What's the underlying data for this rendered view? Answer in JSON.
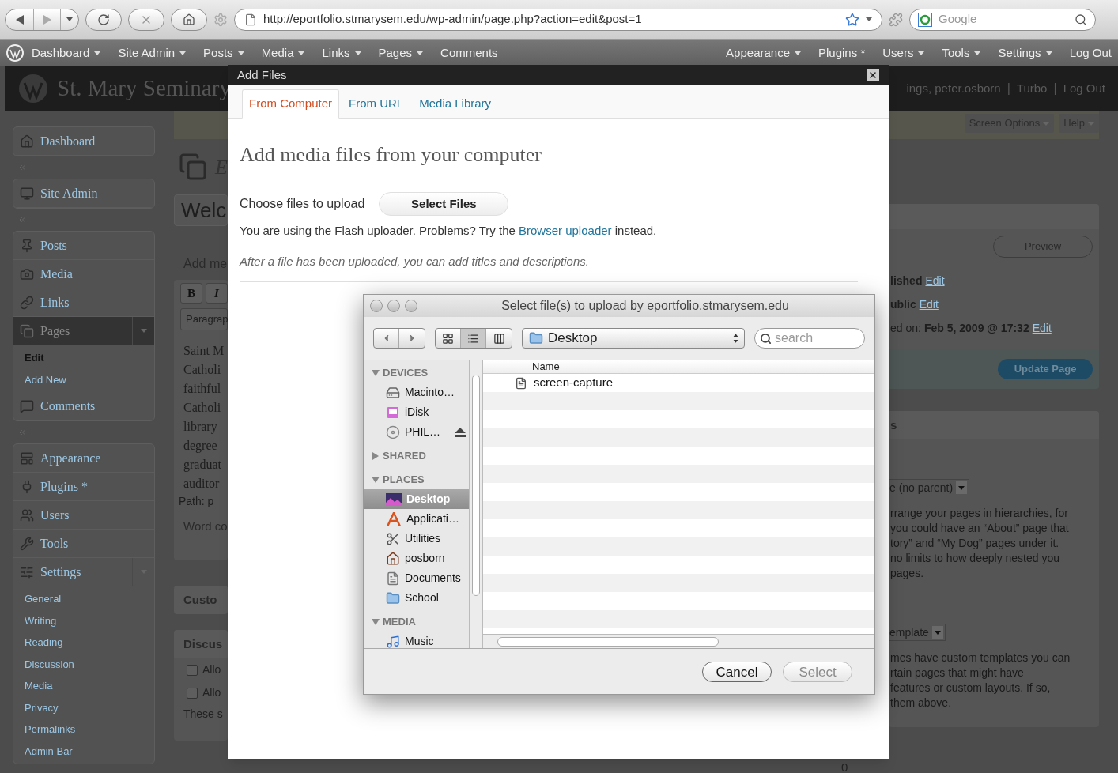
{
  "browser": {
    "url": "http://eportfolio.stmarysem.edu/wp-admin/page.php?action=edit&post=1",
    "search_placeholder": "Google"
  },
  "admin_bar": {
    "left_items": [
      {
        "label": "Dashboard",
        "dropdown": true
      },
      {
        "label": "Site Admin",
        "dropdown": true
      },
      {
        "label": "Posts",
        "dropdown": true
      },
      {
        "label": "Media",
        "dropdown": true
      },
      {
        "label": "Links",
        "dropdown": true
      },
      {
        "label": "Pages",
        "dropdown": true
      },
      {
        "label": "Comments",
        "dropdown": false
      }
    ],
    "right_items": [
      {
        "label": "Appearance",
        "dropdown": true
      },
      {
        "label": "Plugins *",
        "dropdown": false
      },
      {
        "label": "Users",
        "dropdown": true
      },
      {
        "label": "Tools",
        "dropdown": true
      },
      {
        "label": "Settings",
        "dropdown": true
      },
      {
        "label": "Log Out",
        "dropdown": false
      }
    ]
  },
  "header": {
    "site_title": "St. Mary Seminary",
    "user_links": [
      "ings, peter.osborn",
      "Turbo",
      "Log Out"
    ],
    "separator": "|"
  },
  "sidebar": {
    "groups": [
      {
        "items": [
          {
            "label": "Dashboard",
            "selected": false
          }
        ]
      },
      {
        "items": [
          {
            "label": "Site Admin",
            "selected": false
          }
        ]
      },
      {
        "items": [
          {
            "label": "Posts",
            "selected": false
          },
          {
            "label": "Media",
            "selected": false
          },
          {
            "label": "Links",
            "selected": false
          },
          {
            "label": "Pages",
            "selected": true,
            "children": [
              {
                "label": "Edit",
                "selected": true
              },
              {
                "label": "Add New",
                "selected": false
              }
            ]
          },
          {
            "label": "Comments",
            "selected": false
          }
        ]
      },
      {
        "items": [
          {
            "label": "Appearance",
            "selected": false
          },
          {
            "label": "Plugins *",
            "selected": false
          },
          {
            "label": "Users",
            "selected": false
          },
          {
            "label": "Tools",
            "selected": false
          },
          {
            "label": "Settings",
            "selected": false,
            "children": [
              {
                "label": "General",
                "selected": false
              },
              {
                "label": "Writing",
                "selected": false
              },
              {
                "label": "Reading",
                "selected": false
              },
              {
                "label": "Discussion",
                "selected": false
              },
              {
                "label": "Media",
                "selected": false
              },
              {
                "label": "Privacy",
                "selected": false
              },
              {
                "label": "Permalinks",
                "selected": false
              },
              {
                "label": "Admin Bar",
                "selected": false
              }
            ]
          }
        ]
      }
    ]
  },
  "editor": {
    "page_title": "E",
    "title_value": "Welc",
    "add_media": "Add me",
    "toolbar_buttons": [
      "B",
      "I"
    ],
    "format_select": "Paragrap",
    "body_lines": [
      "Saint M",
      "Catholi",
      "faithful",
      "Catholi",
      "library",
      "degree",
      "graduat",
      "auditor"
    ],
    "path": "Path: p",
    "word_count": "Word co",
    "custom_box": "Custo",
    "discussion_box": {
      "title": "Discus",
      "options": [
        {
          "label": "Allo",
          "checked": false
        },
        {
          "label": "Allo",
          "checked": false
        }
      ],
      "note": "These s"
    }
  },
  "right_column": {
    "screen_tabs": [
      "Screen Options",
      "Help"
    ],
    "publish": {
      "preview": "Preview",
      "rows": [
        {
          "value": "lished",
          "link": "Edit"
        },
        {
          "value": "ublic",
          "link": "Edit"
        },
        {
          "label": "ed on:",
          "value": "Feb 5, 2009 @ 17:32",
          "link": "Edit"
        }
      ],
      "update_button": "Update Page"
    },
    "attributes": {
      "heading": "s",
      "parent_select": "e (no parent)",
      "parent_help": [
        "rrange your pages in hierarchies, for",
        "you could have an “About” page that",
        "tory” and “My Dog” pages under it.",
        "no limits to how deeply nested you",
        "pages."
      ],
      "template_select": "emplate",
      "template_help": [
        "mes have custom templates you can",
        "rtain pages that might have",
        "features or custom layouts. If so,",
        "them above."
      ]
    },
    "footer_cell": "0"
  },
  "modal": {
    "title": "Add Files",
    "tabs": [
      {
        "label": "From Computer",
        "selected": true
      },
      {
        "label": "From URL",
        "selected": false
      },
      {
        "label": "Media Library",
        "selected": false
      }
    ],
    "heading": "Add media files from your computer",
    "choose_label": "Choose files to upload",
    "select_button": "Select Files",
    "flash_note": {
      "before": "You are using the Flash uploader. Problems? Try the",
      "link": "Browser uploader",
      "after": "instead."
    },
    "hint": "After a file has been uploaded, you can add titles and descriptions."
  },
  "file_dialog": {
    "title": "Select file(s) to upload by eportfolio.stmarysem.edu",
    "view_modes": [
      {
        "kind": "icons",
        "selected": false
      },
      {
        "kind": "list",
        "selected": true
      },
      {
        "kind": "columns",
        "selected": false
      }
    ],
    "location": "Desktop",
    "search_placeholder": "search",
    "sections": [
      {
        "label": "DEVICES",
        "expanded": true,
        "items": [
          {
            "label": "Macinto…",
            "kind": "disk",
            "selected": false,
            "ejectable": false
          },
          {
            "label": "iDisk",
            "kind": "idisk",
            "selected": false,
            "ejectable": false
          },
          {
            "label": "PHIL…",
            "kind": "cd",
            "selected": false,
            "ejectable": true
          }
        ]
      },
      {
        "label": "SHARED",
        "expanded": false
      },
      {
        "label": "PLACES",
        "expanded": true,
        "items": [
          {
            "label": "Desktop",
            "kind": "desktop",
            "selected": true
          },
          {
            "label": "Applicati…",
            "kind": "apps",
            "selected": false
          },
          {
            "label": "Utilities",
            "kind": "utilities",
            "selected": false
          },
          {
            "label": "posborn",
            "kind": "home",
            "selected": false
          },
          {
            "label": "Documents",
            "kind": "documents",
            "selected": false
          },
          {
            "label": "School",
            "kind": "folder",
            "selected": false
          }
        ]
      },
      {
        "label": "MEDIA",
        "expanded": true,
        "items": [
          {
            "label": "Music",
            "kind": "music",
            "selected": false
          }
        ]
      }
    ],
    "column_header": "Name",
    "files": [
      {
        "name": "screen-capture"
      }
    ],
    "buttons": [
      {
        "label": "Cancel",
        "disabled": false
      },
      {
        "label": "Select",
        "disabled": true
      }
    ]
  }
}
